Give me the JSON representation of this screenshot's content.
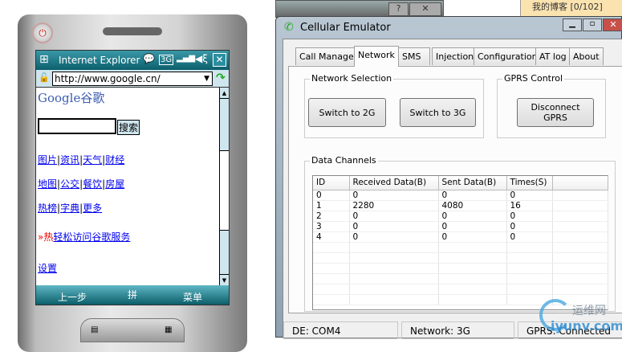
{
  "device": {
    "browser_title": "Internet Explorer",
    "status_icons": [
      "chat-icon",
      "3g-icon",
      "signal-icon",
      "speaker-icon"
    ],
    "url": "http://www.google.cn/",
    "logo_text": "Google谷歌",
    "search_button": "搜索",
    "link_rows": [
      [
        "图片",
        "资讯",
        "天气",
        "财经"
      ],
      [
        "地图",
        "公交",
        "餐饮",
        "房屋"
      ],
      [
        "热榜",
        "字典",
        "更多"
      ]
    ],
    "promo_prefix": "»热",
    "promo_link": "轻松访问谷歌服务",
    "settings_link": "设置",
    "softkeys": {
      "left": "上一步",
      "center": "拼",
      "right": "菜单"
    }
  },
  "background": {
    "right_snippet": "我的博客 [0/102]"
  },
  "window": {
    "title": "Cellular Emulator",
    "tabs": [
      "Call Manager",
      "Network",
      "SMS",
      "Injection",
      "Configuration",
      "AT log",
      "About"
    ],
    "active_tab": "Network",
    "network_selection": {
      "label": "Network Selection",
      "buttons": [
        "Switch to 2G",
        "Switch to 3G"
      ]
    },
    "gprs_control": {
      "label": "GPRS Control",
      "button": "Disconnect GPRS"
    },
    "data_channels": {
      "label": "Data Channels",
      "columns": [
        "ID",
        "Received Data(B)",
        "Sent Data(B)",
        "Times(S)"
      ],
      "rows": [
        [
          "0",
          "0",
          "0",
          "0"
        ],
        [
          "1",
          "2280",
          "4080",
          "16"
        ],
        [
          "2",
          "0",
          "0",
          "0"
        ],
        [
          "3",
          "0",
          "0",
          "0"
        ],
        [
          "4",
          "0",
          "0",
          "0"
        ]
      ]
    },
    "status": [
      "DE: COM4",
      "Network: 3G",
      "GPRS: Connected"
    ]
  },
  "watermark": {
    "text": "运维网",
    "domain": "iyunv.com"
  }
}
